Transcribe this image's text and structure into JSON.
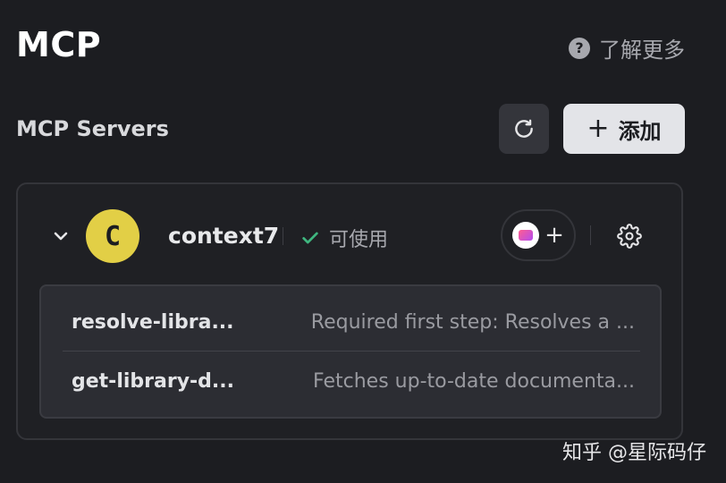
{
  "page": {
    "title": "MCP",
    "learn_more": "了解更多"
  },
  "servers_section": {
    "title": "MCP Servers",
    "add_label": "添加",
    "add_icon": "plus-icon",
    "refresh_icon": "refresh-icon"
  },
  "server": {
    "avatar_letter": "C",
    "name": "context7",
    "status": "可使用",
    "status_color": "#3fb67f",
    "avatar_color": "#e2cf46",
    "tools": [
      {
        "name": "resolve-libra...",
        "description": "Required first step: Resolves a ..."
      },
      {
        "name": "get-library-d...",
        "description": "Fetches up-to-date documenta..."
      }
    ]
  },
  "watermark": "知乎 @星际码仔"
}
